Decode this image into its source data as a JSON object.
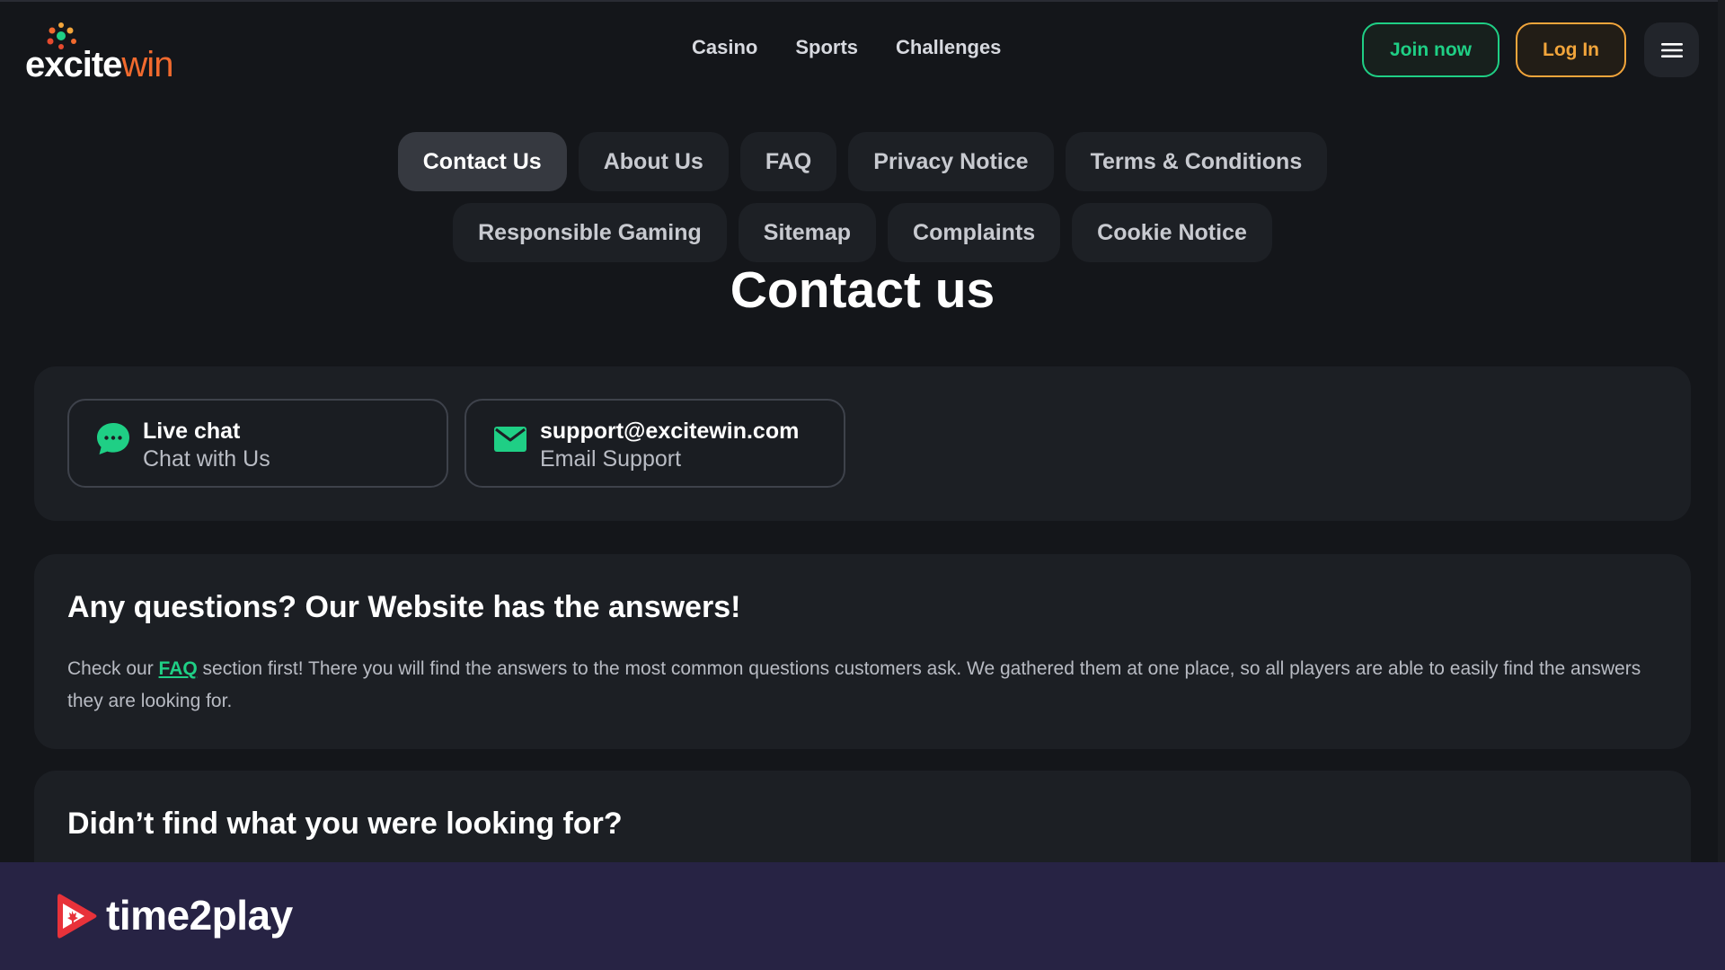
{
  "header": {
    "logo": {
      "text_main": "excite",
      "text_accent": "win"
    },
    "nav": [
      "Casino",
      "Sports",
      "Challenges"
    ],
    "join_label": "Join now",
    "login_label": "Log In",
    "menu_icon": "hamburger-icon"
  },
  "tabs": {
    "row1": [
      "Contact Us",
      "About Us",
      "FAQ",
      "Privacy Notice",
      "Terms & Conditions"
    ],
    "row2": [
      "Responsible Gaming",
      "Sitemap",
      "Complaints",
      "Cookie Notice"
    ],
    "active": "Contact Us"
  },
  "page_title": "Contact us",
  "contact_cards": [
    {
      "title": "Live chat",
      "subtitle": "Chat with Us",
      "icon": "chat-bubble-icon"
    },
    {
      "title": "support@excitewin.com",
      "subtitle": "Email Support",
      "icon": "envelope-icon"
    }
  ],
  "faq_section": {
    "title": "Any questions? Our Website has the answers!",
    "text_before": "Check our ",
    "link": "FAQ",
    "text_after": " section first! There you will find the answers to the most common questions customers ask. We gathered them at one place, so all players are able to easily find the answers they are looking for."
  },
  "not_found_section": {
    "title": "Didn’t find what you were looking for?"
  },
  "banner": {
    "brand": "time2play"
  },
  "colors": {
    "background": "#14161a",
    "panel": "#1c1f24",
    "accent_green": "#1fcf85",
    "accent_orange": "#f2a53b",
    "logo_orange": "#f26a2e",
    "banner": "#272344"
  }
}
